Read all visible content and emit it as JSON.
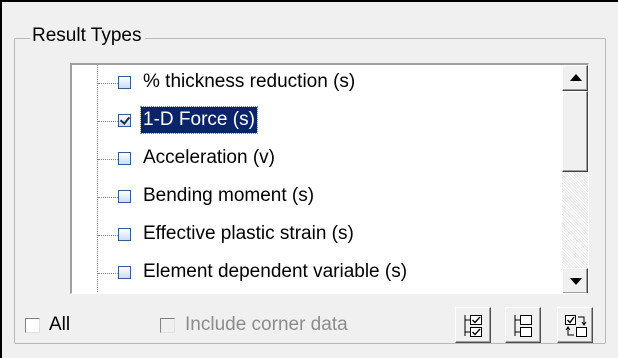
{
  "panel": {
    "group_title": "Result Types"
  },
  "tree": {
    "items": [
      {
        "label": "% thickness reduction (s)",
        "checked": false,
        "selected": false
      },
      {
        "label": "1-D Force (s)",
        "checked": true,
        "selected": true
      },
      {
        "label": "Acceleration (v)",
        "checked": false,
        "selected": false
      },
      {
        "label": "Bending moment (s)",
        "checked": false,
        "selected": false
      },
      {
        "label": "Effective plastic strain (s)",
        "checked": false,
        "selected": false
      },
      {
        "label": "Element dependent variable (s)",
        "checked": false,
        "selected": false
      }
    ]
  },
  "options": {
    "all_label": "All",
    "all_checked": false,
    "corner_label": "Include corner data",
    "corner_enabled": false
  },
  "toolbar": {
    "icons": [
      "check-all-icon",
      "uncheck-all-icon",
      "invert-selection-icon"
    ]
  }
}
